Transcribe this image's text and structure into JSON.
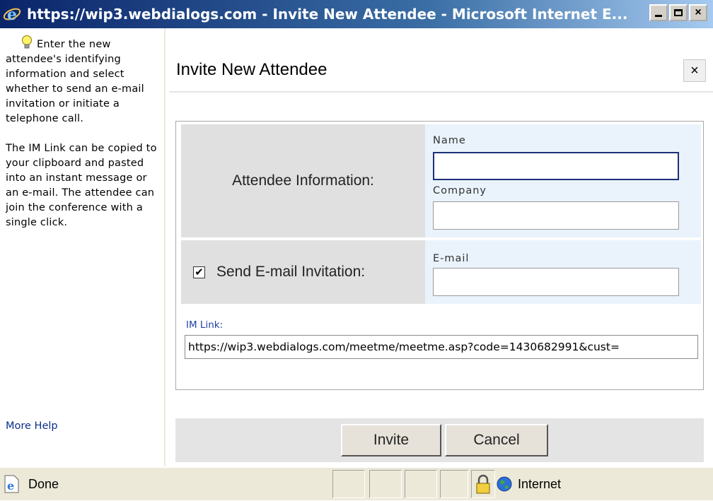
{
  "window": {
    "title": "https://wip3.webdialogs.com - Invite New Attendee - Microsoft Internet E...",
    "minimize_icon": "minimize-icon",
    "maximize_icon": "maximize-icon",
    "close_label": "×"
  },
  "sidebar": {
    "tip_icon": "lightbulb-icon",
    "tip_text_1": "Enter the new attendee's identifying information and select whether to send an e-mail invitation or initiate a telephone call.",
    "tip_text_2": "The IM Link can be copied to your clipboard and pasted into an instant message or an e-mail. The attendee can join the conference with a single click.",
    "more_help": "More Help"
  },
  "dialog": {
    "title": "Invite New Attendee",
    "close_label": "×",
    "attendee_info_label": "Attendee Information:",
    "name_label": "Name",
    "name_value": "",
    "company_label": "Company",
    "company_value": "",
    "send_email_label": "Send E-mail Invitation:",
    "send_email_checked": true,
    "checkbox_mark": "✔",
    "email_label": "E-mail",
    "email_value": "",
    "im_link_label": "IM Link:",
    "im_link_value": "https://wip3.webdialogs.com/meetme/meetme.asp?code=1430682991&cust=",
    "invite_button": "Invite",
    "cancel_button": "Cancel"
  },
  "statusbar": {
    "status_text": "Done",
    "zone_text": "Internet",
    "lock_icon": "padlock-icon",
    "zone_icon": "globe-icon"
  },
  "colors": {
    "titlebar_start": "#0a246a",
    "panel_label_bg": "#e0e0e0",
    "panel_field_bg": "#eaf3fb",
    "link": "#1f3fa8"
  }
}
